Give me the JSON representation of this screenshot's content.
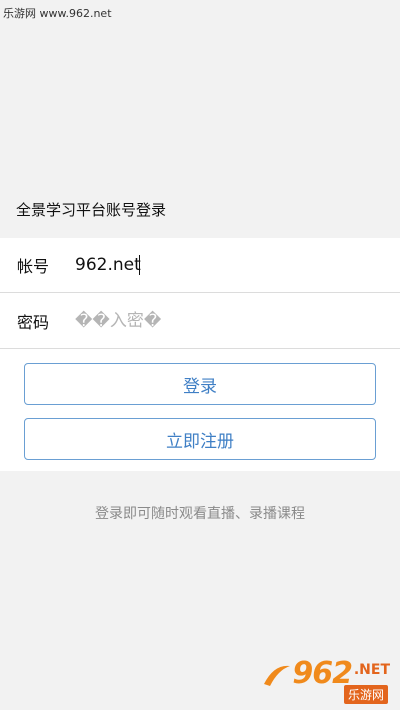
{
  "watermark_top": "乐游网 www.962.net",
  "form": {
    "title": "全景学习平台账号登录",
    "account_label": "帐号",
    "account_value": "962.net",
    "password_label": "密码",
    "password_placeholder": "��入密�"
  },
  "buttons": {
    "login": "登录",
    "register": "立即注册"
  },
  "hint": "登录即可随时观看直播、录播课程",
  "logo": {
    "main": "962",
    "suffix": ".NET",
    "cn": "乐游网"
  },
  "colors": {
    "background": "#f2f2f2",
    "card": "#ffffff",
    "accent": "#3f7fc5",
    "button_border": "#6a9fd3",
    "hint": "#8a8a8a"
  }
}
